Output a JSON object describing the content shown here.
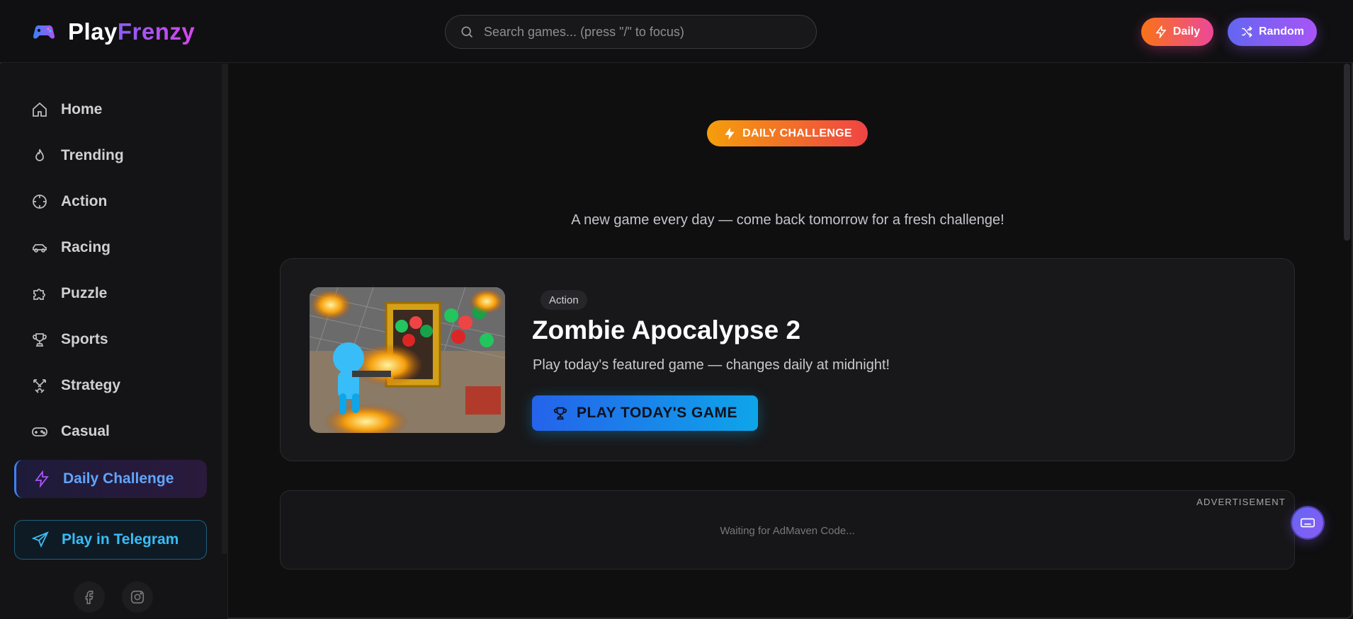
{
  "brand": {
    "name_part1": "Play",
    "name_part2": "Frenzy"
  },
  "search": {
    "placeholder": "Search games... (press \"/\" to focus)"
  },
  "header_buttons": {
    "daily_label": "Daily",
    "random_label": "Random"
  },
  "sidebar": {
    "items": [
      {
        "label": "Home",
        "icon": "home-icon"
      },
      {
        "label": "Trending",
        "icon": "flame-icon"
      },
      {
        "label": "Action",
        "icon": "crosshair-icon"
      },
      {
        "label": "Racing",
        "icon": "car-icon"
      },
      {
        "label": "Puzzle",
        "icon": "puzzle-icon"
      },
      {
        "label": "Sports",
        "icon": "trophy-icon"
      },
      {
        "label": "Strategy",
        "icon": "swords-icon"
      },
      {
        "label": "Casual",
        "icon": "gamepad-icon"
      },
      {
        "label": "Daily Challenge",
        "icon": "lightning-icon",
        "active": true
      },
      {
        "label": "Play in Telegram",
        "icon": "send-icon"
      }
    ],
    "socials": [
      "facebook-icon",
      "instagram-icon"
    ]
  },
  "main": {
    "badge": "DAILY CHALLENGE",
    "tagline": "A new game every day — come back tomorrow for a fresh challenge!",
    "featured": {
      "genre": "Action",
      "title": "Zombie Apocalypse 2",
      "description": "Play today's featured game — changes daily at midnight!",
      "play_label": "PLAY TODAY'S GAME"
    },
    "ad": {
      "label": "ADVERTISEMENT",
      "status": "Waiting for AdMaven Code..."
    }
  },
  "colors": {
    "accent_blue": "#3b82f6",
    "accent_purple": "#8b5cf6",
    "accent_orange": "#f97316",
    "accent_pink": "#ec4899",
    "background": "#0f0f10"
  }
}
